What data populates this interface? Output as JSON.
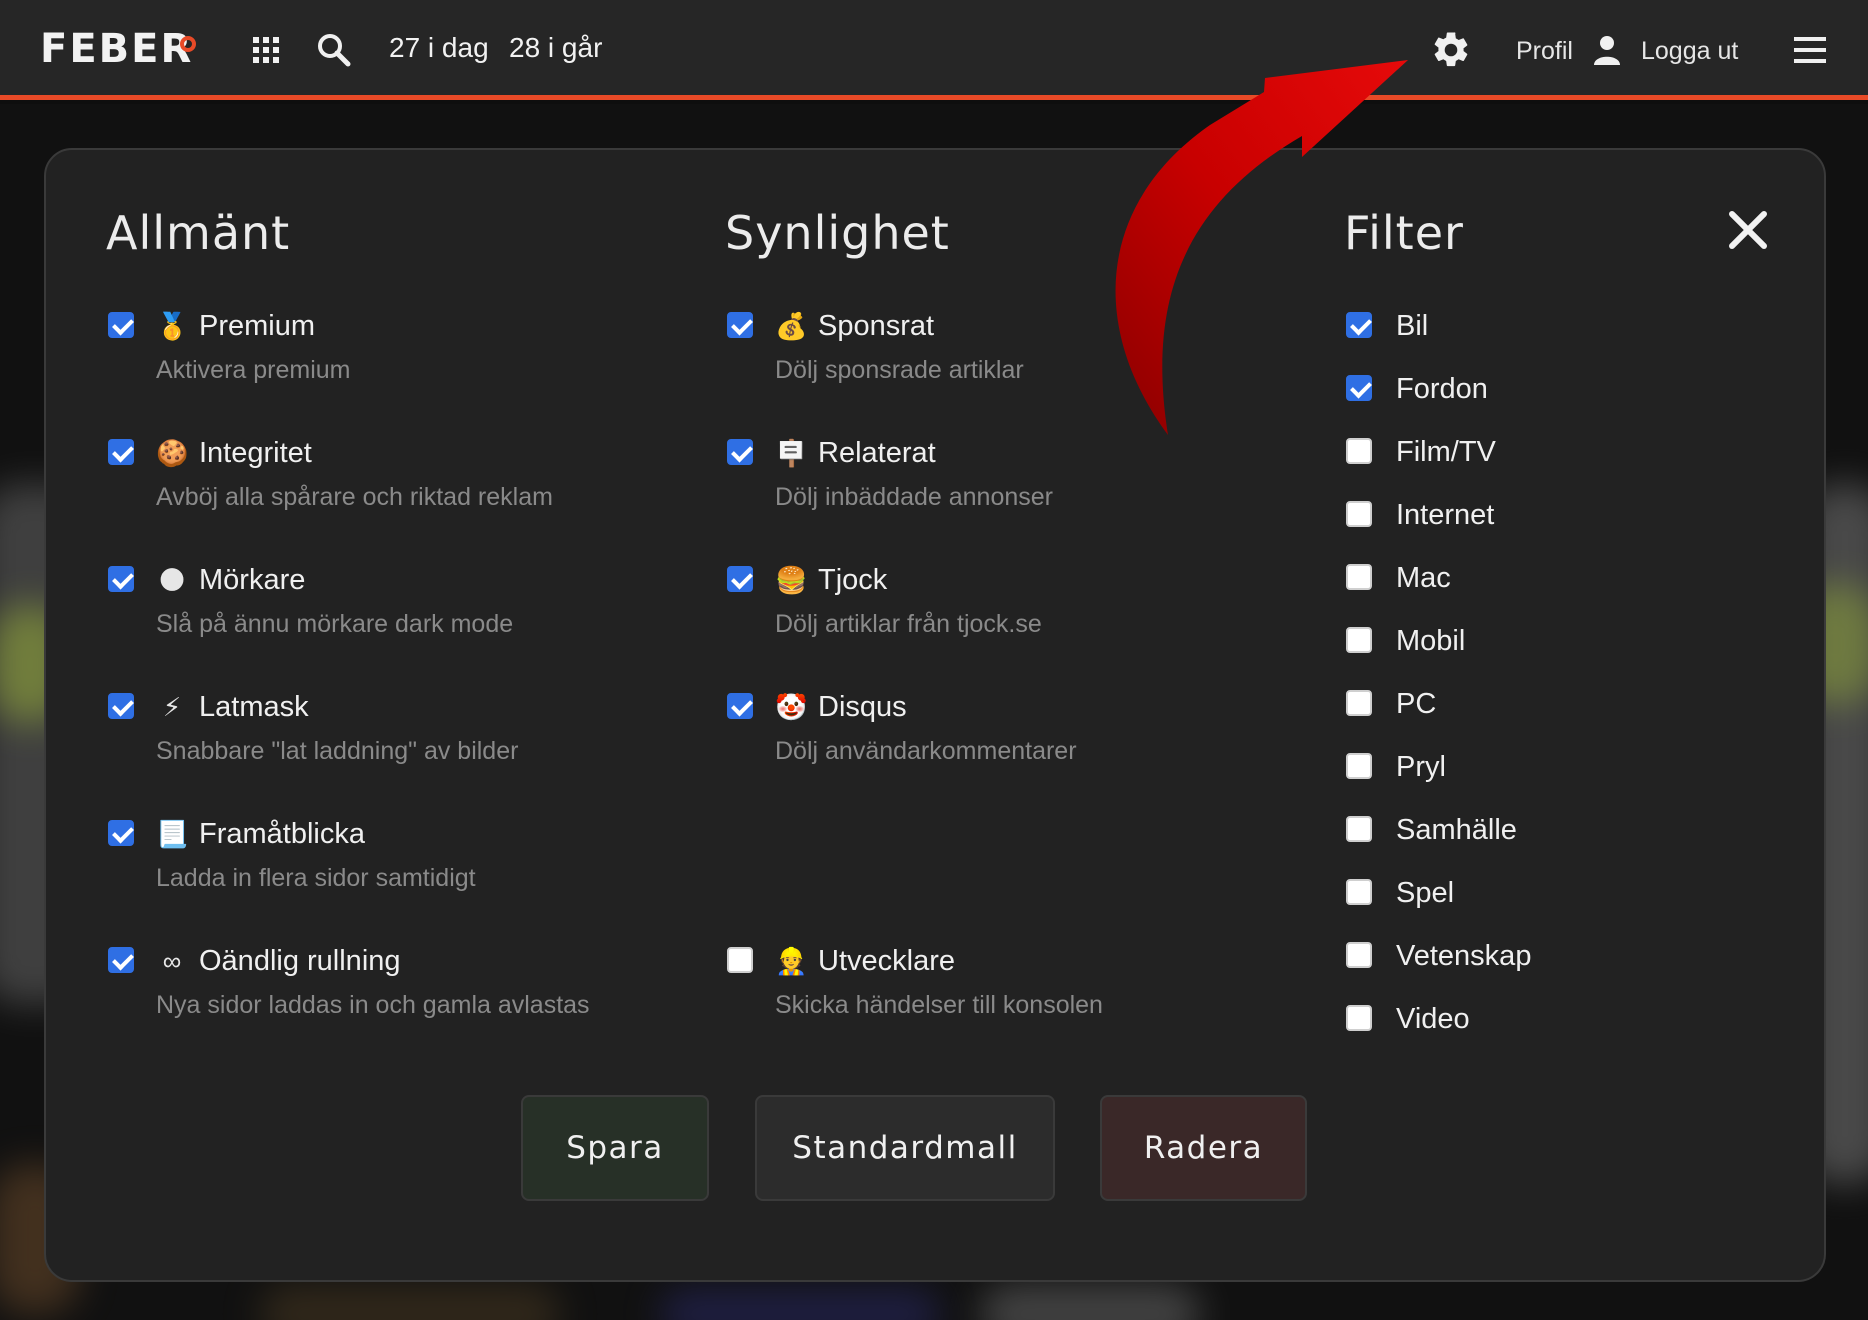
{
  "navbar": {
    "logo": "FEBER",
    "today": "27 i dag",
    "yesterday": "28 i går",
    "profile": "Profil",
    "logout": "Logga ut",
    "icons": [
      "apps-grid-icon",
      "search-icon",
      "gear-icon",
      "user-icon",
      "hamburger-menu-icon"
    ]
  },
  "modal": {
    "columns": [
      {
        "title": "Allmänt",
        "options": [
          {
            "emoji": "🥇",
            "label": "Premium",
            "desc": "Aktivera premium",
            "checked": true
          },
          {
            "emoji": "🍪",
            "label": "Integritet",
            "desc": "Avböj alla spårare och riktad reklam",
            "checked": true
          },
          {
            "emoji": "🌑",
            "label": "Mörkare",
            "desc": "Slå på ännu mörkare dark mode",
            "checked": true
          },
          {
            "emoji": "⚡",
            "label": "Latmask",
            "desc": "Snabbare \"lat laddning\" av bilder",
            "checked": true
          },
          {
            "emoji": "📃",
            "label": "Framåtblicka",
            "desc": "Ladda in flera sidor samtidigt",
            "checked": true
          },
          {
            "emoji": "∞",
            "label": "Oändlig rullning",
            "desc": "Nya sidor laddas in och gamla avlastas",
            "checked": true
          }
        ]
      },
      {
        "title": "Synlighet",
        "options": [
          {
            "emoji": "💰",
            "label": "Sponsrat",
            "desc": "Dölj sponsrade artiklar",
            "checked": true
          },
          {
            "emoji": "🪧",
            "label": "Relaterat",
            "desc": "Dölj inbäddade annonser",
            "checked": true
          },
          {
            "emoji": "🍔",
            "label": "Tjock",
            "desc": "Dölj artiklar från tjock.se",
            "checked": true
          },
          {
            "emoji": "🤡",
            "label": "Disqus",
            "desc": "Dölj användarkommentarer",
            "checked": true
          },
          {
            "emoji": "👷",
            "label": "Utvecklare",
            "desc": "Skicka händelser till konsolen",
            "checked": false
          }
        ]
      },
      {
        "title": "Filter",
        "options": [
          {
            "label": "Bil",
            "checked": true
          },
          {
            "label": "Fordon",
            "checked": true
          },
          {
            "label": "Film/TV",
            "checked": false
          },
          {
            "label": "Internet",
            "checked": false
          },
          {
            "label": "Mac",
            "checked": false
          },
          {
            "label": "Mobil",
            "checked": false
          },
          {
            "label": "PC",
            "checked": false
          },
          {
            "label": "Pryl",
            "checked": false
          },
          {
            "label": "Samhälle",
            "checked": false
          },
          {
            "label": "Spel",
            "checked": false
          },
          {
            "label": "Vetenskap",
            "checked": false
          },
          {
            "label": "Video",
            "checked": false
          }
        ]
      }
    ],
    "buttons": {
      "save": "Spara",
      "default": "Standardmall",
      "delete": "Radera"
    }
  },
  "colors": {
    "accent": "#e84a27",
    "checkbox": "#2f6fe4",
    "arrow": "#d40000",
    "save_bg": "#273027",
    "default_bg": "#2c2c2c",
    "delete_bg": "#3a2828"
  }
}
